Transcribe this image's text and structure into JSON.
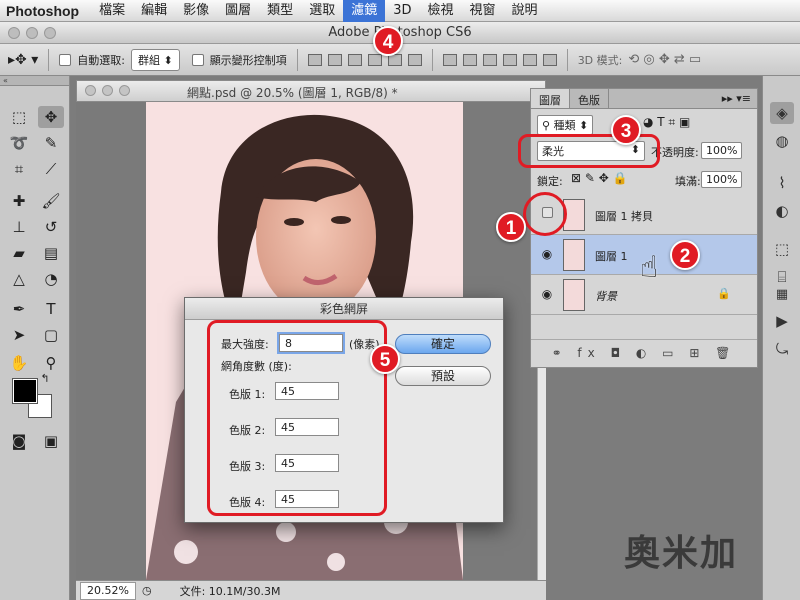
{
  "app": {
    "name": "Photoshop"
  },
  "menu": [
    "檔案",
    "編輯",
    "影像",
    "圖層",
    "類型",
    "選取",
    "濾鏡",
    "3D",
    "檢視",
    "視窗",
    "說明"
  ],
  "window_title": "Adobe Photoshop CS6",
  "options_bar": {
    "auto_select_label": "自動選取:",
    "auto_select_value": "群組",
    "show_transform_label": "顯示變形控制項",
    "mode_3d_label": "3D 模式:"
  },
  "document": {
    "title": "網點.psd @ 20.5% (圖層 1, RGB/8) *",
    "zoom": "20.52%",
    "file_info": "文件: 10.1M/30.3M"
  },
  "layers_panel": {
    "tabs": [
      "圖層",
      "色版"
    ],
    "filter_kind": "種類",
    "blend_mode": "柔光",
    "opacity_label": "不透明度:",
    "opacity_value": "100%",
    "lock_label": "鎖定:",
    "fill_label": "填滿:",
    "fill_value": "100%",
    "layers": [
      {
        "name": "圖層 1 拷貝",
        "visible": false,
        "selected": false
      },
      {
        "name": "圖層 1",
        "visible": true,
        "selected": true
      },
      {
        "name": "背景",
        "visible": true,
        "selected": false,
        "locked": true
      }
    ]
  },
  "dialog": {
    "title": "彩色網屏",
    "max_radius_label": "最大強度:",
    "max_radius_value": "8",
    "unit_label": "(像素)",
    "angles_label": "網角度數 (度):",
    "channels": [
      {
        "label": "色版 1:",
        "value": "45"
      },
      {
        "label": "色版 2:",
        "value": "45"
      },
      {
        "label": "色版 3:",
        "value": "45"
      },
      {
        "label": "色版 4:",
        "value": "45"
      }
    ],
    "ok_label": "確定",
    "default_label": "預設"
  },
  "annotations": [
    "1",
    "2",
    "3",
    "4",
    "5"
  ],
  "watermark": "奧米加",
  "colors": {
    "highlight": "#e01b24",
    "menu_active": "#3b73d6",
    "selected_layer": "#b4c8ea"
  }
}
